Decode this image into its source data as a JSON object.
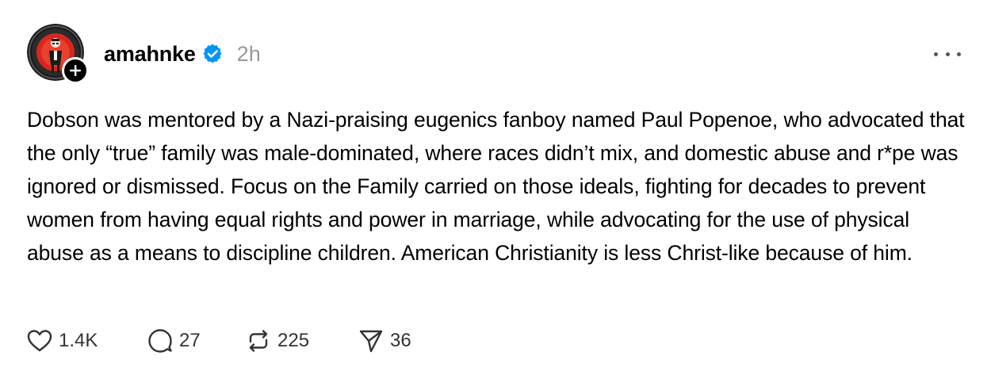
{
  "post": {
    "username": "amahnke",
    "timestamp": "2h",
    "body": "Dobson was mentored by a Nazi-praising eugenics fanboy named Paul Popenoe, who advocated that the only “true” family was male-dominated, where races didn’t mix, and domestic abuse and r*pe was ignored or dismissed. Focus on the Family carried on those ideals, fighting for decades to prevent women from having equal rights and power in marriage, while advocating for the use of physical abuse as a means to discipline children. American Christianity is less Christ-like because of him.",
    "verified": true
  },
  "actions": {
    "likes": "1.4K",
    "replies": "27",
    "reposts": "225",
    "shares": "36"
  },
  "icons": {
    "avatar": "avatar-image",
    "follow": "plus-icon",
    "verified": "verified-badge-icon",
    "more": "more-horizontal-icon",
    "like": "heart-icon",
    "reply": "comment-icon",
    "repost": "repost-icon",
    "share": "send-icon"
  },
  "colors": {
    "verified": "#0095F6",
    "muted": "#999999",
    "text": "#000000"
  }
}
